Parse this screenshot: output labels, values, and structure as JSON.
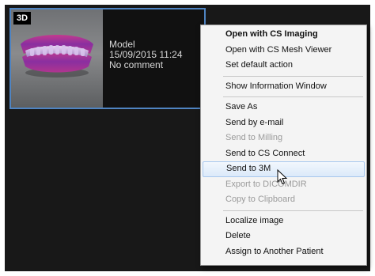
{
  "card": {
    "badge": "3D",
    "type": "Model",
    "datetime": "15/09/2015 11:24",
    "comment": "No comment",
    "border_color": "#4f84c2"
  },
  "menu": {
    "items": [
      {
        "label": "Open with CS Imaging",
        "bold": true,
        "disabled": false
      },
      {
        "label": "Open with CS Mesh Viewer",
        "bold": false,
        "disabled": false
      },
      {
        "label": "Set default action",
        "bold": false,
        "disabled": false
      },
      {
        "label": "Show Information Window",
        "bold": false,
        "disabled": false
      },
      {
        "label": "Save As",
        "bold": false,
        "disabled": false
      },
      {
        "label": "Send by e-mail",
        "bold": false,
        "disabled": false
      },
      {
        "label": "Send to Milling",
        "bold": false,
        "disabled": true
      },
      {
        "label": "Send to CS Connect",
        "bold": false,
        "disabled": false
      },
      {
        "label": "Send to 3M",
        "bold": false,
        "disabled": false,
        "hovered": true
      },
      {
        "label": "Export to DICOMDIR",
        "bold": false,
        "disabled": true
      },
      {
        "label": "Copy to Clipboard",
        "bold": false,
        "disabled": true
      },
      {
        "label": "Localize image",
        "bold": false,
        "disabled": false
      },
      {
        "label": "Delete",
        "bold": false,
        "disabled": false
      },
      {
        "label": "Assign to Another Patient",
        "bold": false,
        "disabled": false
      }
    ]
  },
  "icons": {
    "thumbnail": "dental-arch-model-icon",
    "cursor": "mouse-pointer-icon"
  }
}
